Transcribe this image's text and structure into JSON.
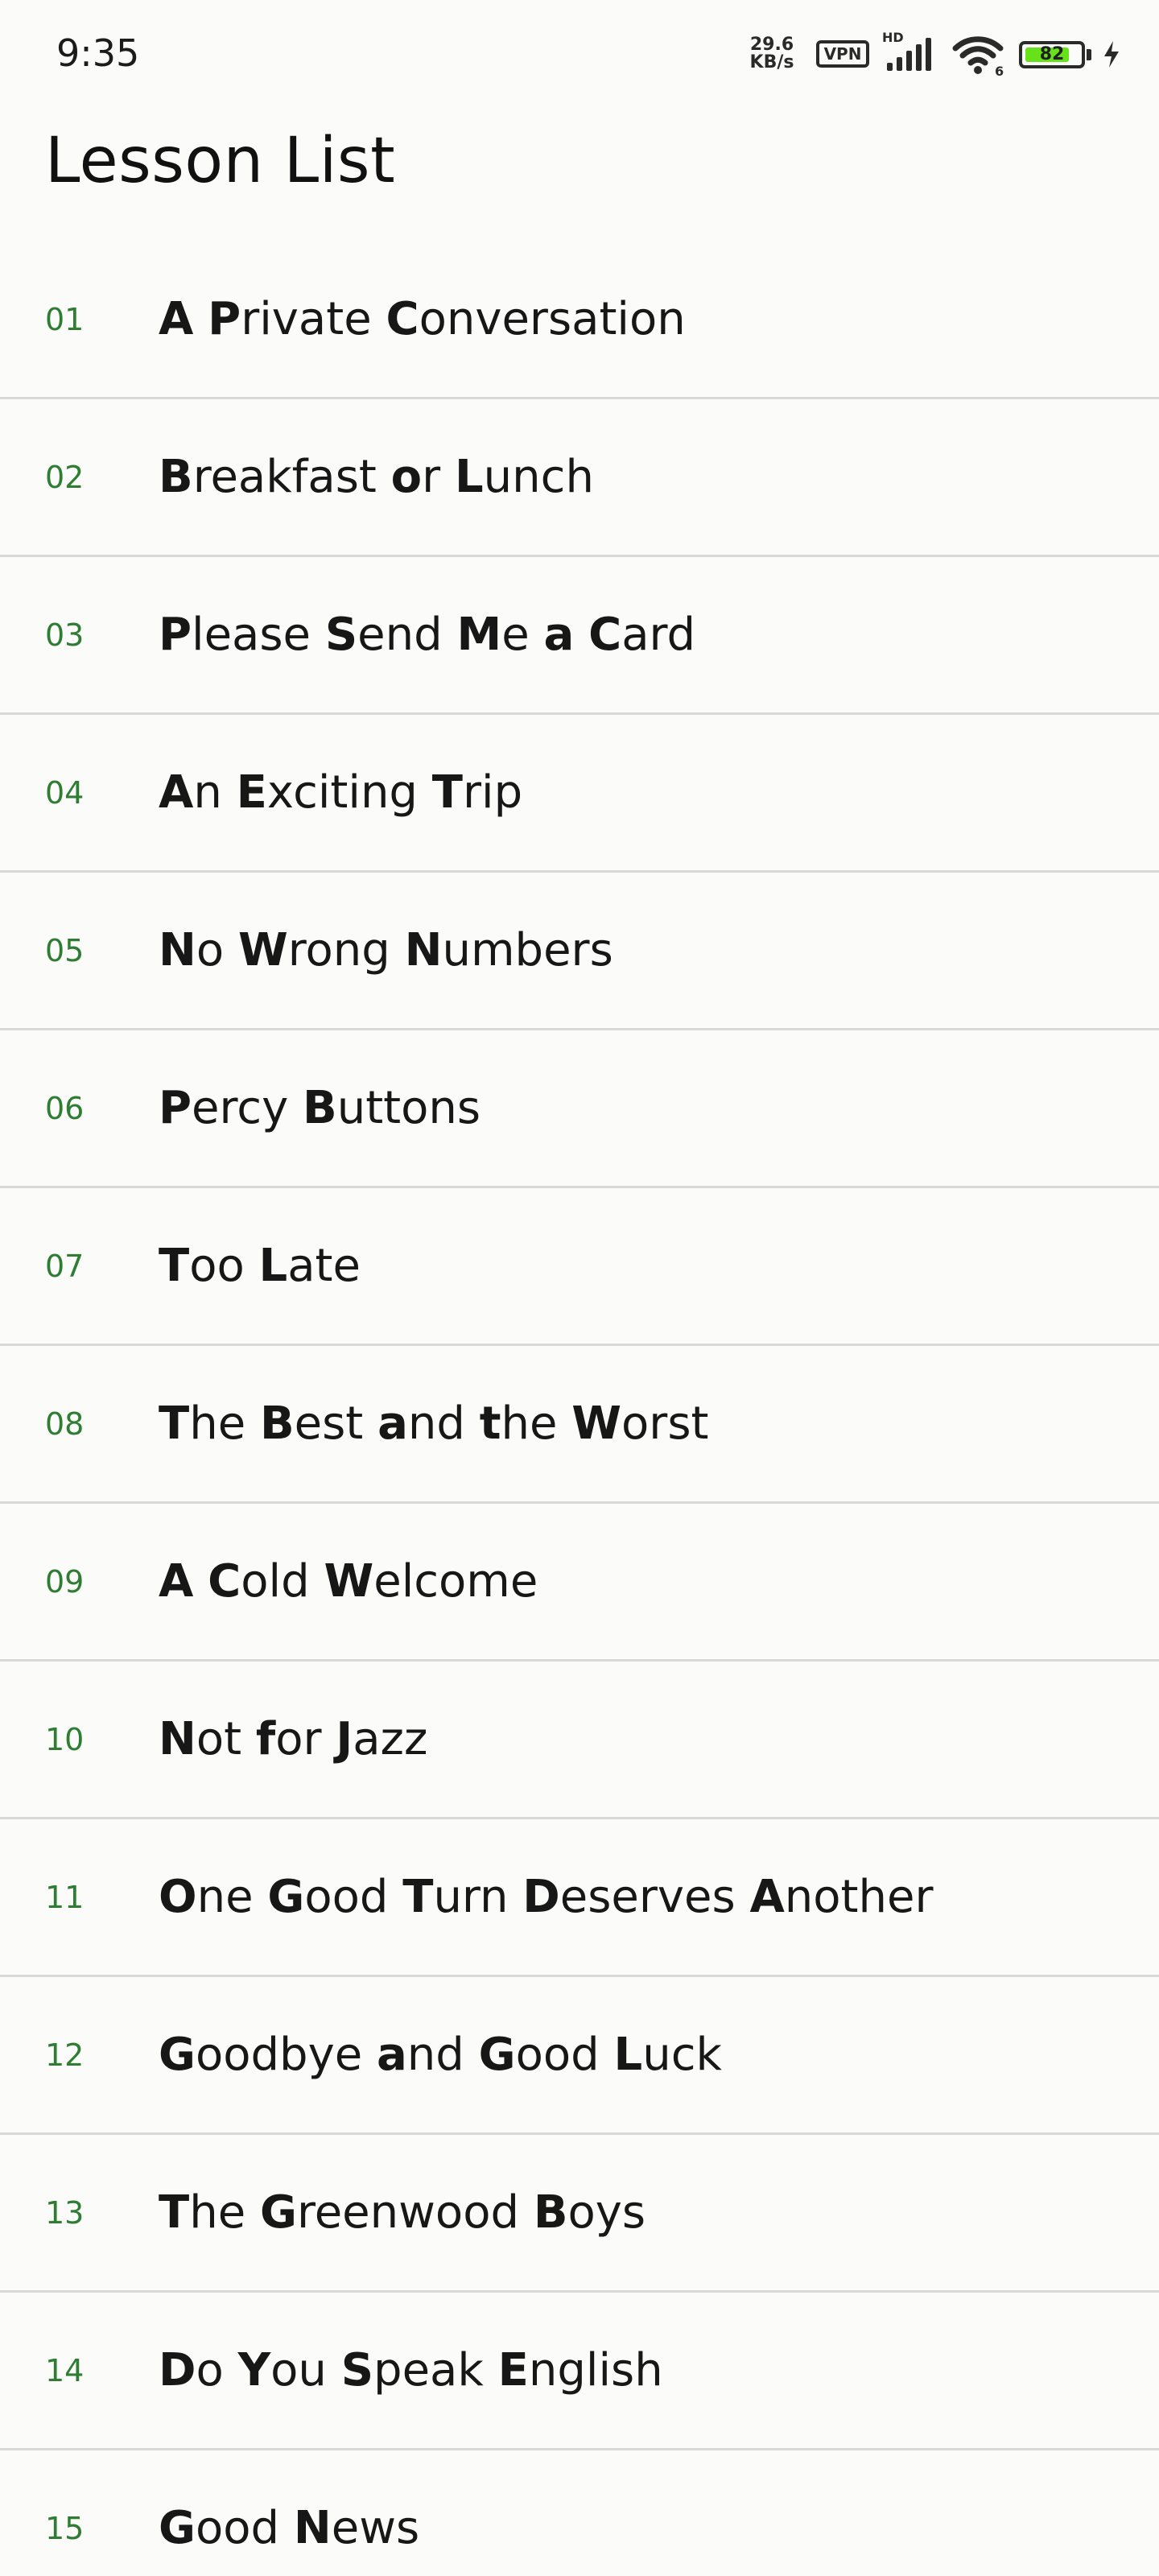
{
  "status_bar": {
    "time": "9:35",
    "network_speed": {
      "value": "29.6",
      "unit": "KB/s"
    },
    "vpn_label": "VPN",
    "signal_label": "HD",
    "wifi_badge": "6",
    "battery_level": "82",
    "battery_fill": 0.82,
    "icons": {
      "signal": "signal-bars-icon",
      "wifi": "wifi-icon",
      "battery": "battery-icon",
      "charging": "charging-bolt-icon"
    },
    "colors": {
      "battery_fill": "#67e21a",
      "icon": "#2a2a2a"
    }
  },
  "page": {
    "title": "Lesson List"
  },
  "theme": {
    "lesson_number_color": "#2e7d32",
    "divider_color": "#d9d9d6",
    "background": "#fbfbf9"
  },
  "lessons": [
    {
      "number": "01",
      "title": "A Private Conversation"
    },
    {
      "number": "02",
      "title": "Breakfast or Lunch"
    },
    {
      "number": "03",
      "title": "Please Send Me a Card"
    },
    {
      "number": "04",
      "title": "An Exciting Trip"
    },
    {
      "number": "05",
      "title": "No Wrong Numbers"
    },
    {
      "number": "06",
      "title": "Percy Buttons"
    },
    {
      "number": "07",
      "title": "Too Late"
    },
    {
      "number": "08",
      "title": "The Best and the Worst"
    },
    {
      "number": "09",
      "title": "A Cold Welcome"
    },
    {
      "number": "10",
      "title": "Not for Jazz"
    },
    {
      "number": "11",
      "title": "One Good Turn Deserves Another"
    },
    {
      "number": "12",
      "title": "Goodbye and Good Luck"
    },
    {
      "number": "13",
      "title": "The Greenwood Boys"
    },
    {
      "number": "14",
      "title": "Do You Speak English"
    },
    {
      "number": "15",
      "title": "Good News"
    }
  ]
}
